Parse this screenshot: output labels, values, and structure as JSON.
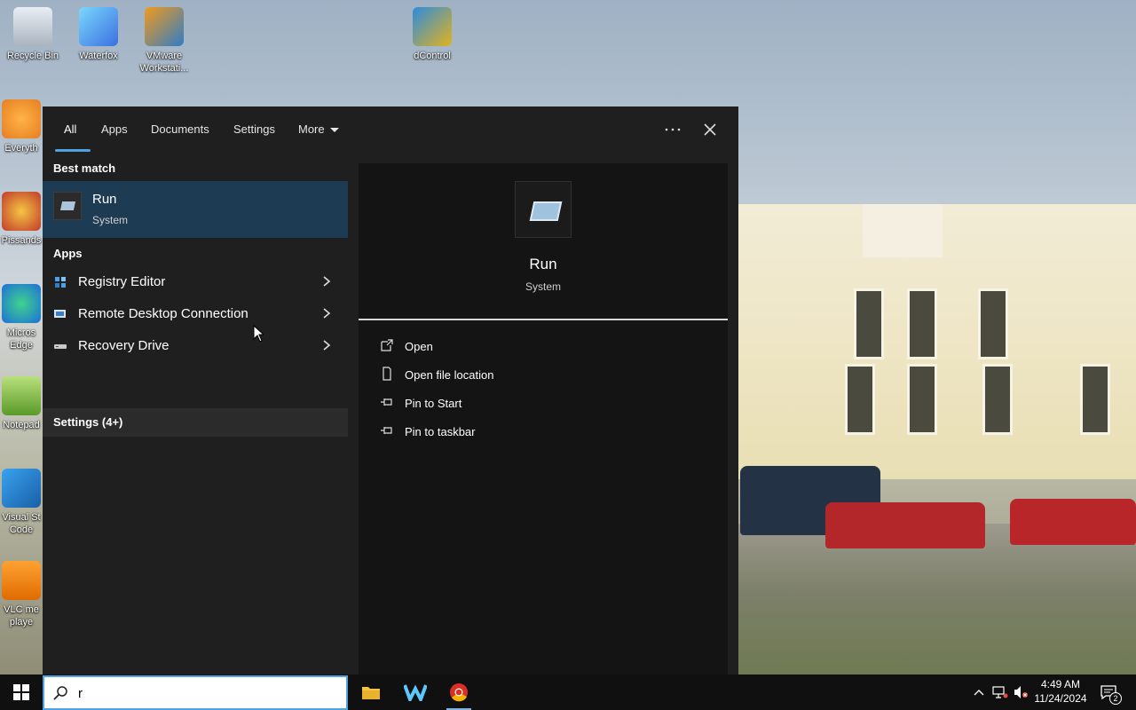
{
  "desktop": {
    "icons": [
      {
        "label": "Recycle Bin",
        "icon": "recycle-bin-icon"
      },
      {
        "label": "Waterfox",
        "icon": "waterfox-icon"
      },
      {
        "label": "VMware Workstati...",
        "icon": "vmware-icon"
      },
      {
        "label": "dControl",
        "icon": "dcontrol-icon"
      },
      {
        "label": "Everyth",
        "icon": "everything-icon"
      },
      {
        "label": "Pissands",
        "icon": "pissands-icon"
      },
      {
        "label": "Micros Edge",
        "icon": "edge-icon"
      },
      {
        "label": "Notepad",
        "icon": "notepad-icon"
      },
      {
        "label": "Visual St Code",
        "icon": "vscode-icon"
      },
      {
        "label": "VLC me playe",
        "icon": "vlc-icon"
      }
    ]
  },
  "search": {
    "tabs": [
      {
        "label": "All",
        "active": true
      },
      {
        "label": "Apps"
      },
      {
        "label": "Documents"
      },
      {
        "label": "Settings"
      },
      {
        "label": "More"
      }
    ],
    "best_match_header": "Best match",
    "best_match": {
      "title": "Run",
      "subtitle": "System",
      "icon": "run-icon"
    },
    "apps_header": "Apps",
    "apps": [
      {
        "label": "Registry Editor",
        "icon": "registry-editor-icon"
      },
      {
        "label": "Remote Desktop Connection",
        "icon": "remote-desktop-icon"
      },
      {
        "label": "Recovery Drive",
        "icon": "recovery-drive-icon"
      }
    ],
    "settings_row": "Settings (4+)",
    "preview": {
      "title": "Run",
      "subtitle": "System"
    },
    "actions": [
      {
        "label": "Open",
        "icon": "open-icon"
      },
      {
        "label": "Open file location",
        "icon": "file-location-icon"
      },
      {
        "label": "Pin to Start",
        "icon": "pin-icon"
      },
      {
        "label": "Pin to taskbar",
        "icon": "pin-icon"
      }
    ],
    "query": "r"
  },
  "taskbar": {
    "apps": [
      "file-explorer-icon",
      "waterfox-icon",
      "chrome-icon"
    ],
    "time": "4:49 AM",
    "date": "11/24/2024",
    "notifications": "2"
  },
  "colors": {
    "accent": "#4fa3e0",
    "selection": "#1d3b53",
    "panel_bg": "#1f1f1f",
    "preview_bg": "#141414",
    "taskbar_bg": "#101010"
  }
}
